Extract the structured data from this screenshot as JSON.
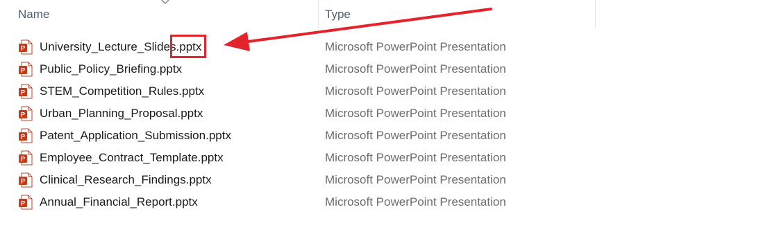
{
  "header": {
    "name_label": "Name",
    "type_label": "Type"
  },
  "files": [
    {
      "name": "University_Lecture_Slides.pptx",
      "type": "Microsoft PowerPoint Presentation"
    },
    {
      "name": "Public_Policy_Briefing.pptx",
      "type": "Microsoft PowerPoint Presentation"
    },
    {
      "name": "STEM_Competition_Rules.pptx",
      "type": "Microsoft PowerPoint Presentation"
    },
    {
      "name": "Urban_Planning_Proposal.pptx",
      "type": "Microsoft PowerPoint Presentation"
    },
    {
      "name": "Patent_Application_Submission.pptx",
      "type": "Microsoft PowerPoint Presentation"
    },
    {
      "name": "Employee_Contract_Template.pptx",
      "type": "Microsoft PowerPoint Presentation"
    },
    {
      "name": "Clinical_Research_Findings.pptx",
      "type": "Microsoft PowerPoint Presentation"
    },
    {
      "name": "Annual_Financial_Report.pptx",
      "type": "Microsoft PowerPoint Presentation"
    }
  ],
  "icons": {
    "file": "powerpoint-file-icon",
    "sort": "chevron-down-icon"
  },
  "colors": {
    "annotation": "#e3242b",
    "powerpoint": "#c43e1c"
  }
}
